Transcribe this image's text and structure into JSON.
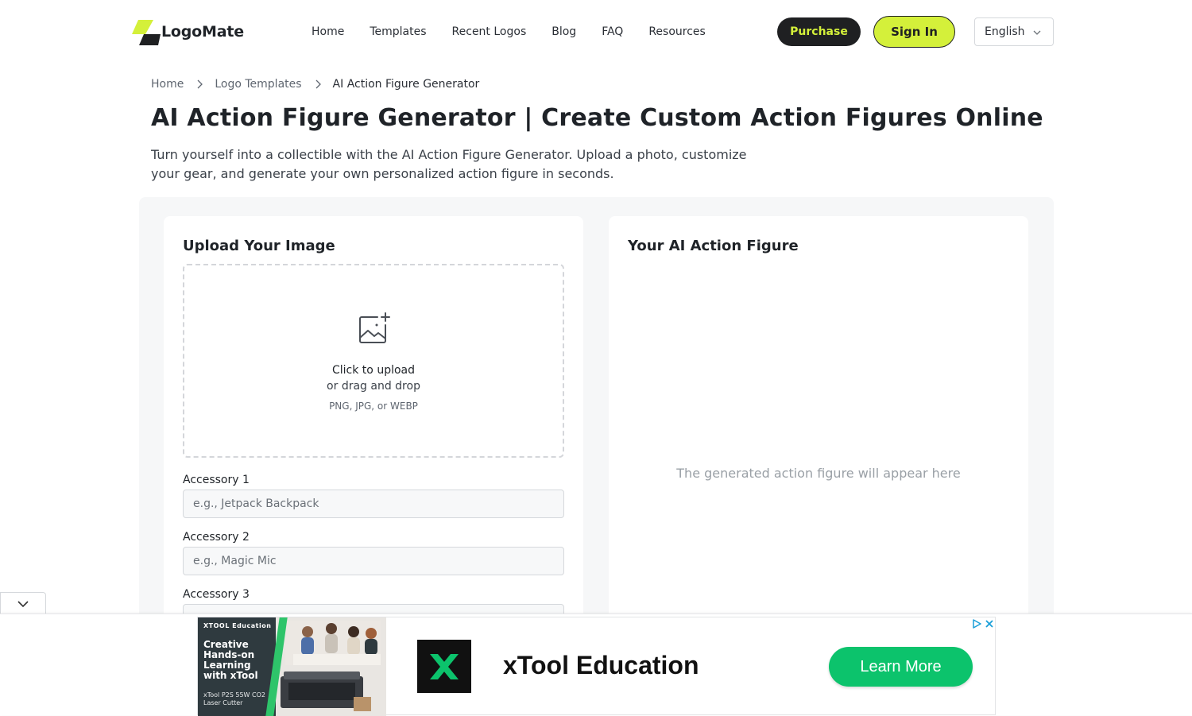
{
  "header": {
    "logo_text": "LogoMate",
    "nav": [
      "Home",
      "Templates",
      "Recent Logos",
      "Blog",
      "FAQ",
      "Resources"
    ],
    "purchase_label": "Purchase",
    "signin_label": "Sign In",
    "language": "English",
    "accent_color": "#d4f03a"
  },
  "breadcrumb": [
    "Home",
    "Logo Templates",
    "AI Action Figure Generator"
  ],
  "page": {
    "title": "AI Action Figure Generator | Create Custom Action Figures Online",
    "description": "Turn yourself into a collectible with the AI Action Figure Generator. Upload a photo, customize your gear, and generate your own personalized action figure in seconds."
  },
  "upload": {
    "title": "Upload Your Image",
    "click_text": "Click to upload",
    "drag_text": "or drag and drop",
    "formats": "PNG, JPG, or WEBP",
    "icon": "image-add-icon"
  },
  "accessories": [
    {
      "label": "Accessory 1",
      "value": "",
      "placeholder": "e.g., Jetpack Backpack"
    },
    {
      "label": "Accessory 2",
      "value": "",
      "placeholder": "e.g., Magic Mic"
    },
    {
      "label": "Accessory 3",
      "value": "",
      "placeholder": ""
    }
  ],
  "result": {
    "title": "Your AI Action Figure",
    "placeholder": "The generated action figure will appear here"
  },
  "ad": {
    "image_brand": "XTOOL Education",
    "image_headline": "Creative Hands-on Learning with xTool",
    "image_caption": "xTool P2S 55W CO2 Laser Cutter",
    "title": "xTool Education",
    "cta": "Learn More",
    "cta_color": "#0cc36c"
  }
}
